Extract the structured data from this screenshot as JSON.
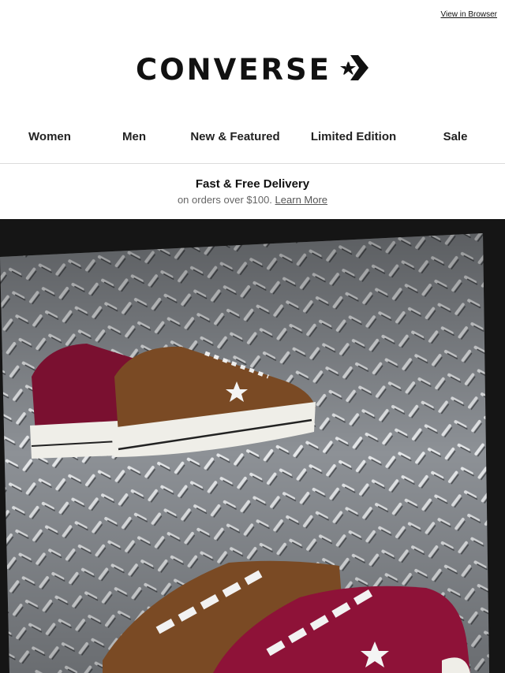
{
  "topbar": {
    "view_in_browser": "View in Browser"
  },
  "brand": {
    "name": "CONVERSE",
    "logo_icon": "star-chevron-icon"
  },
  "nav": {
    "items": [
      {
        "label": "Women"
      },
      {
        "label": "Men"
      },
      {
        "label": "New & Featured"
      },
      {
        "label": "Limited Edition"
      },
      {
        "label": "Sale"
      }
    ]
  },
  "promo": {
    "title": "Fast & Free Delivery",
    "subtitle": "on orders over $100.",
    "link": "Learn More"
  },
  "colors": {
    "burgundy": "#7a1030",
    "brown": "#7a4a24",
    "metal": "#9a9ea3"
  }
}
